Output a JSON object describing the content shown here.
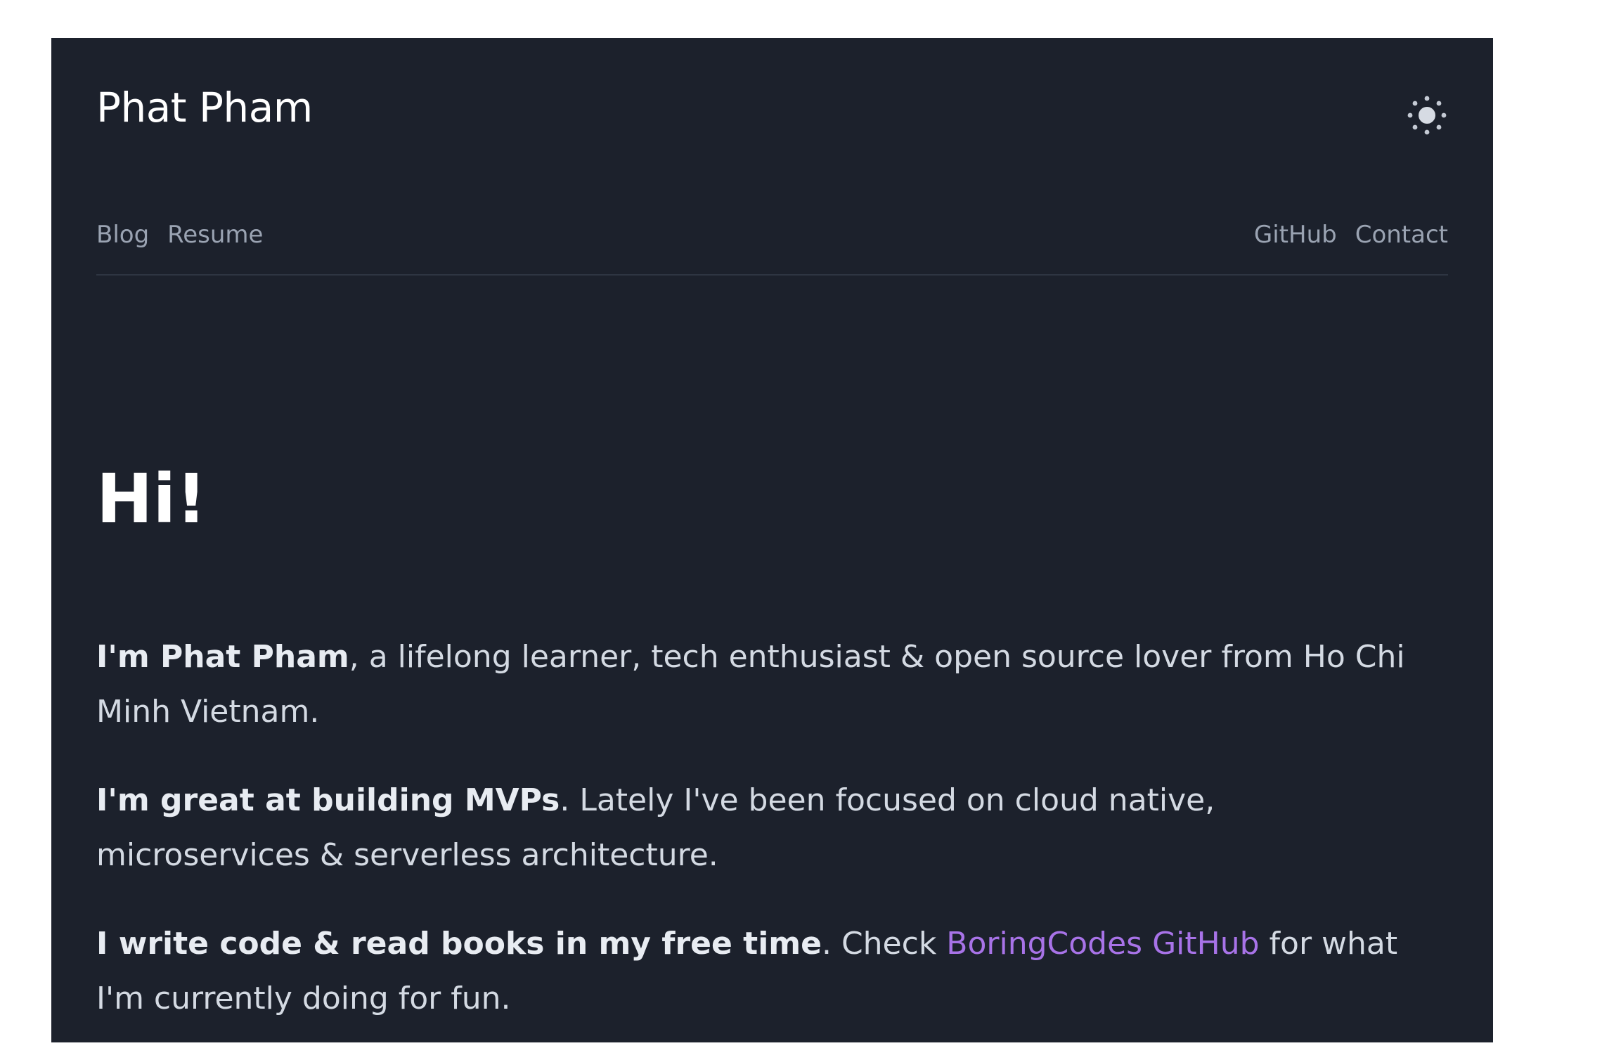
{
  "site": {
    "title": "Phat Pham"
  },
  "nav": {
    "left": [
      {
        "label": "Blog"
      },
      {
        "label": "Resume"
      }
    ],
    "right": [
      {
        "label": "GitHub"
      },
      {
        "label": "Contact"
      }
    ]
  },
  "theme_toggle": {
    "icon": "sun-icon"
  },
  "hero": {
    "heading": "Hi!"
  },
  "intro": {
    "p1": {
      "bold": "I'm Phat Pham",
      "rest": ", a lifelong learner, tech enthusiast & open source lover from Ho Chi Minh Vietnam."
    },
    "p2": {
      "bold": "I'm great at building MVPs",
      "rest": ". Lately I've been focused on cloud native, microservices & serverless architecture."
    },
    "p3": {
      "bold": "I write code & read books in my free time",
      "mid": ". Check ",
      "link": "BoringCodes GitHub",
      "rest": " for what I'm currently doing for fun."
    }
  },
  "colors": {
    "background": "#1c212c",
    "accent": "#a873e8",
    "muted": "#9aa3b2",
    "text": "#d4dae3"
  }
}
